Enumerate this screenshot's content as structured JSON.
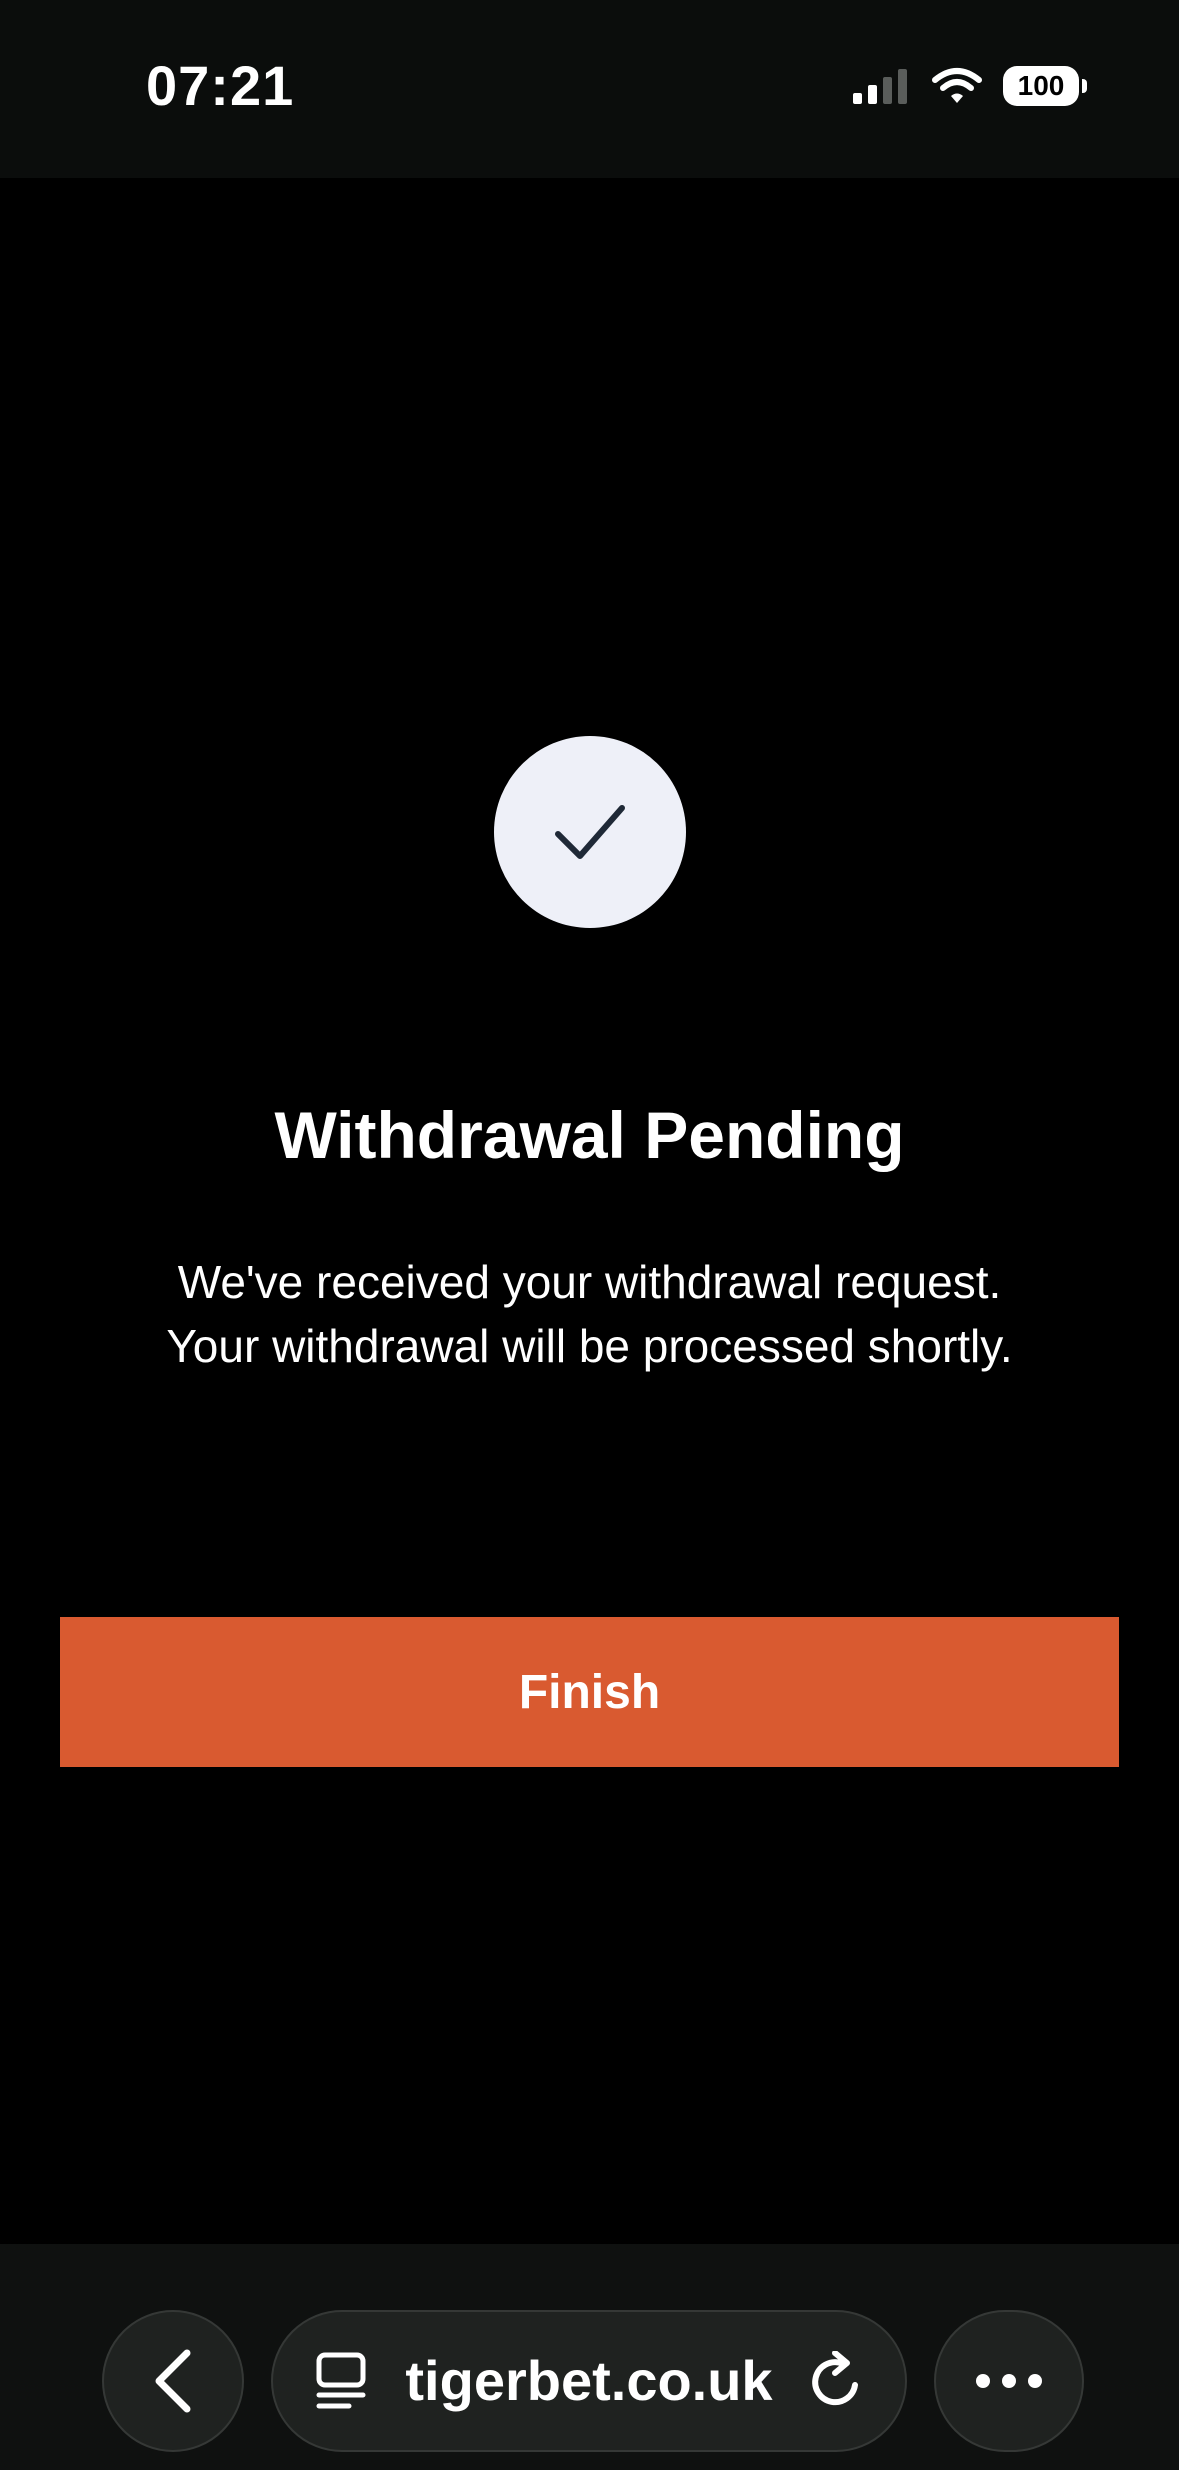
{
  "status_bar": {
    "time": "07:21",
    "battery": "100",
    "icons": [
      "signal-icon",
      "wifi-icon",
      "battery-icon"
    ]
  },
  "main": {
    "status_icon": "checkmark-icon",
    "title": "Withdrawal Pending",
    "message_line1": "We've received your withdrawal request.",
    "message_line2": "Your withdrawal will be processed shortly.",
    "finish_label": "Finish"
  },
  "browser": {
    "url": "tigerbet.co.uk",
    "icons": [
      "back-icon",
      "tabs-icon",
      "reload-icon",
      "more-icon"
    ]
  },
  "colors": {
    "background": "#000000",
    "accent_button": "#d95a30",
    "check_circle": "#eef0f8",
    "check_stroke": "#1f2937",
    "browser_bar": "#0f1110"
  }
}
